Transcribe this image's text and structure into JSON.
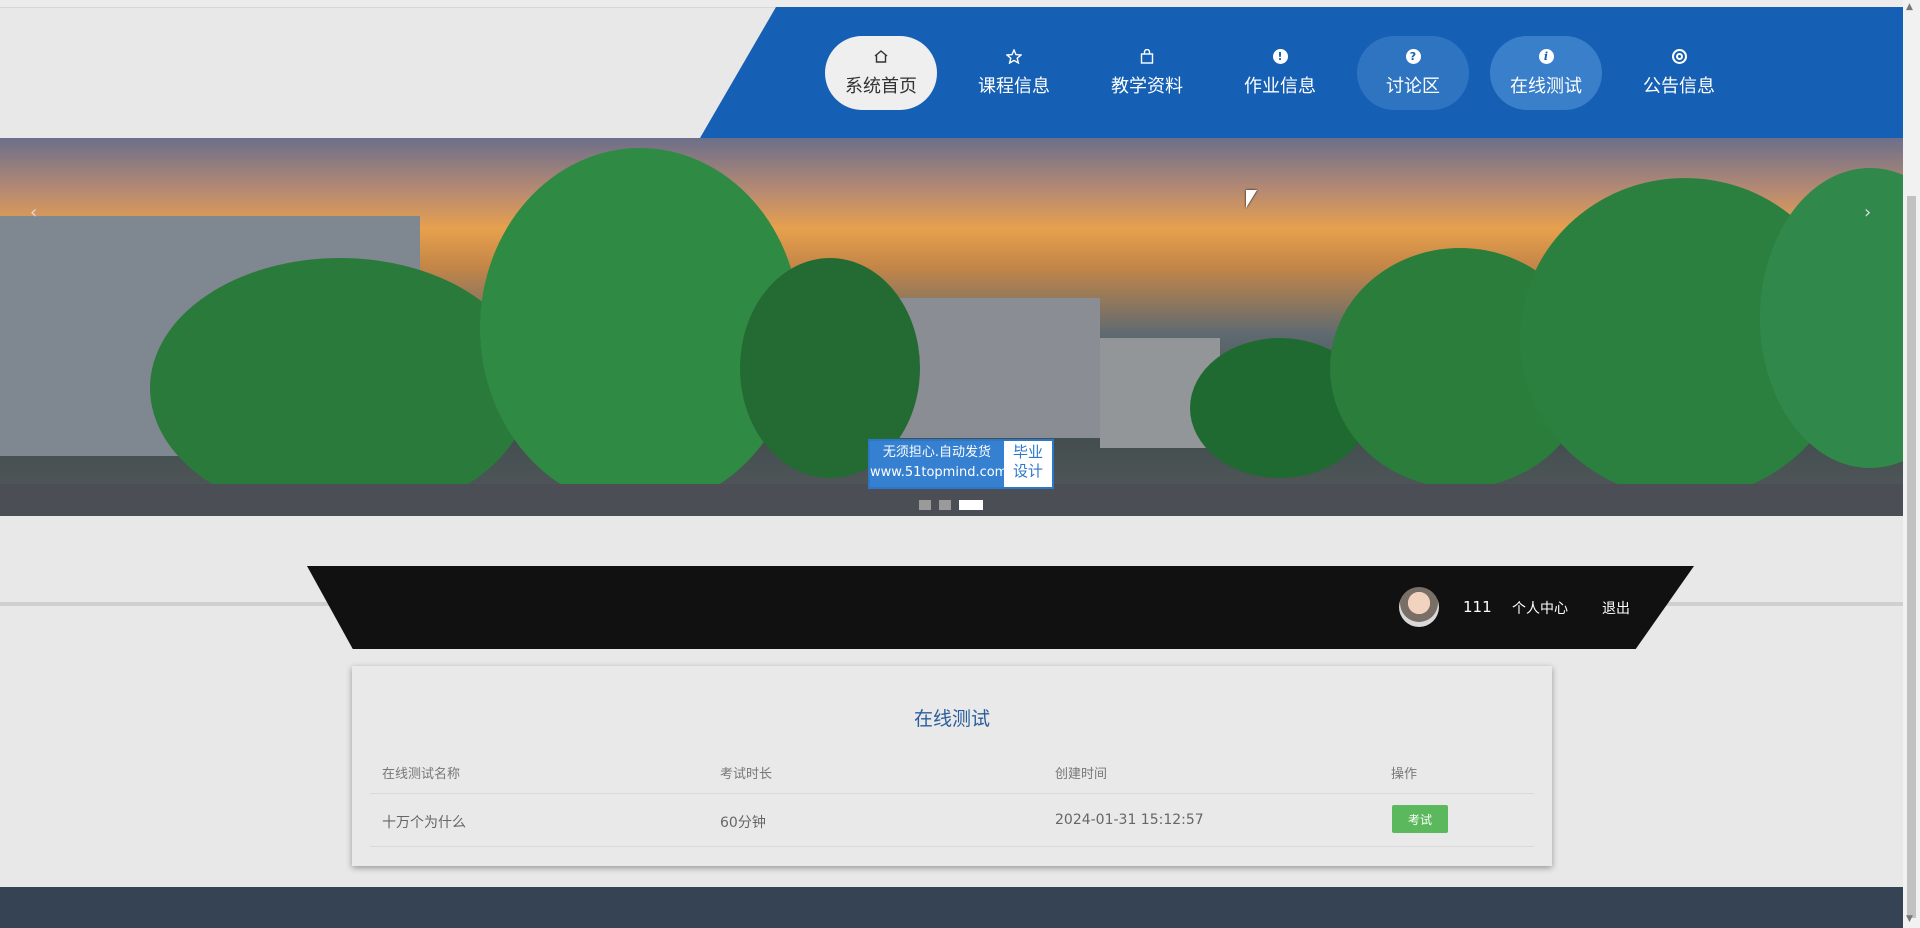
{
  "nav": {
    "items": [
      {
        "label": "系统首页",
        "icon": "home-icon",
        "state": "active"
      },
      {
        "label": "课程信息",
        "icon": "star-icon",
        "state": "normal"
      },
      {
        "label": "教学资料",
        "icon": "bag-icon",
        "state": "normal"
      },
      {
        "label": "作业信息",
        "icon": "exclamation-icon",
        "state": "normal"
      },
      {
        "label": "讨论区",
        "icon": "question-icon",
        "state": "hover"
      },
      {
        "label": "在线测试",
        "icon": "info-icon",
        "state": "hover"
      },
      {
        "label": "公告信息",
        "icon": "lifebuoy-icon",
        "state": "normal"
      }
    ],
    "colors": {
      "bar": "#1560b4",
      "active_bg": "#efefef"
    }
  },
  "banner": {
    "prev": "‹",
    "next": "›",
    "watermark": {
      "line1": "无须担心.自动发货",
      "line2": "www.51topmind.com",
      "side1": "毕业",
      "side2": "设计"
    },
    "slide_count": 3,
    "active_slide": 3
  },
  "user": {
    "name": "111",
    "center_link": "个人中心",
    "logout_link": "退出"
  },
  "test_panel": {
    "title": "在线测试",
    "columns": [
      "在线测试名称",
      "考试时长",
      "创建时间",
      "操作"
    ],
    "rows": [
      {
        "name": "十万个为什么",
        "duration": "60分钟",
        "created": "2024-01-31 15:12:57",
        "action": "考试"
      }
    ],
    "action_color": "#5cb85c"
  }
}
